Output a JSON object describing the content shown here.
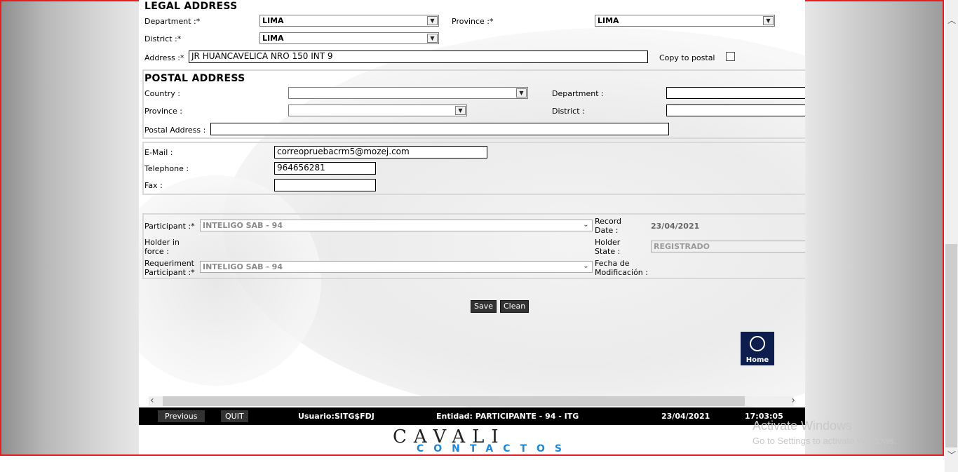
{
  "legal_address": {
    "title": "LEGAL ADDRESS",
    "department_label": "Department :*",
    "department_value": "LIMA",
    "province_label": "Province :*",
    "province_value": "LIMA",
    "district_label": "District :*",
    "district_value": "LIMA",
    "address_label": "Address :*",
    "address_value": "JR HUANCAVELICA NRO 150 INT 9",
    "copy_label": "Copy to postal"
  },
  "postal_address": {
    "title": "POSTAL ADDRESS",
    "country_label": "Country :",
    "country_value": "",
    "department_label": "Department :",
    "department_value": "",
    "province_label": "Province :",
    "province_value": "",
    "district_label": "District :",
    "district_value": "",
    "postal_label": "Postal Address :",
    "postal_value": ""
  },
  "contact": {
    "email_label": "E-Mail :",
    "email_value": "correopruebacrm5@mozej.com",
    "phone_label": "Telephone :",
    "phone_value": "964656281",
    "fax_label": "Fax :",
    "fax_value": ""
  },
  "participant": {
    "participant_label": "Participant :*",
    "participant_value": "INTELIGO SAB - 94",
    "record_date_label": "Record Date :",
    "record_date_value": "23/04/2021",
    "holder_force_label": "Holder in force :",
    "holder_state_label": "Holder State :",
    "holder_state_value": "REGISTRADO",
    "req_label": "Requeriment Participant :*",
    "req_value": "INTELIGO SAB - 94",
    "mod_label": "Fecha de Modificación :"
  },
  "actions": {
    "save": "Save",
    "clean": "Clean",
    "home": "Home"
  },
  "footer": {
    "previous": "Previous",
    "quit": "QUIT",
    "usuario": "Usuario:SITG$FDJ",
    "entidad": "Entidad: PARTICIPANTE - 94 - ITG",
    "date": "23/04/2021",
    "time": "17:03:05"
  },
  "logo": {
    "top": "CAVALI",
    "bottom": "CONTACTOS"
  },
  "watermark": {
    "line1": "Activate Windows",
    "line2": "Go to Settings to activate Windows."
  },
  "icons": {
    "dropdown": "chevron-down-icon",
    "home": "home-icon"
  },
  "colors": {
    "accent_border": "#e31e24",
    "footer_bg": "#000000",
    "logo_blue": "#1e88d8",
    "home_bg": "#0d1d4e"
  }
}
